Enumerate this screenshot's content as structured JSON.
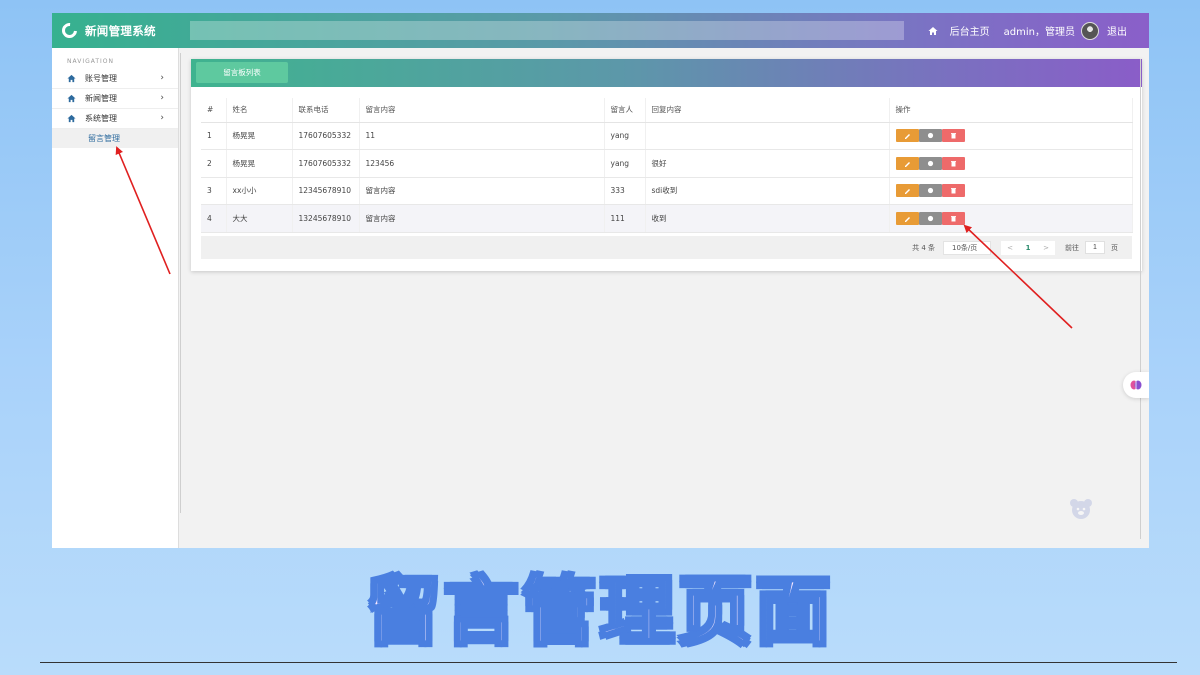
{
  "app": {
    "title": "新闻管理系统",
    "home_label": "后台主页",
    "user_label": "admin，管理员",
    "logout_label": "退出"
  },
  "sidebar": {
    "nav_title": "NAVIGATION",
    "items": [
      {
        "label": "账号管理",
        "icon": "home-icon"
      },
      {
        "label": "新闻管理",
        "icon": "home-icon"
      },
      {
        "label": "系统管理",
        "icon": "home-icon"
      }
    ],
    "sub_item": "留言管理"
  },
  "panel": {
    "tab_label": "留言板列表"
  },
  "table": {
    "headers": [
      "#",
      "姓名",
      "联系电话",
      "留言内容",
      "留言人",
      "回复内容",
      "操作"
    ],
    "rows": [
      [
        "1",
        "杨晃晃",
        "17607605332",
        "11",
        "yang",
        ""
      ],
      [
        "2",
        "杨晃晃",
        "17607605332",
        "123456",
        "yang",
        "很好"
      ],
      [
        "3",
        "xx小小",
        "12345678910",
        "留言内容",
        "333",
        "sdi收到"
      ],
      [
        "4",
        "大大",
        "13245678910",
        "留言内容",
        "111",
        "收到"
      ]
    ],
    "action_icons": [
      "edit-icon",
      "view-icon",
      "delete-icon"
    ]
  },
  "pager": {
    "total_label": "共 4 条",
    "page_size_label": "10条/页",
    "prev": "<",
    "current": "1",
    "next": ">",
    "goto_label": "前往",
    "goto_value": "1",
    "page_unit": "页"
  },
  "caption": "留言管理页面",
  "colors": {
    "accent_green": "#36b18f",
    "accent_purple": "#8a5fc9",
    "edit": "#e89b36",
    "view": "#8e8e8e",
    "delete": "#ee6a6a",
    "annotation_arrow": "#e02020",
    "caption_stroke": "#4a7fe0"
  }
}
